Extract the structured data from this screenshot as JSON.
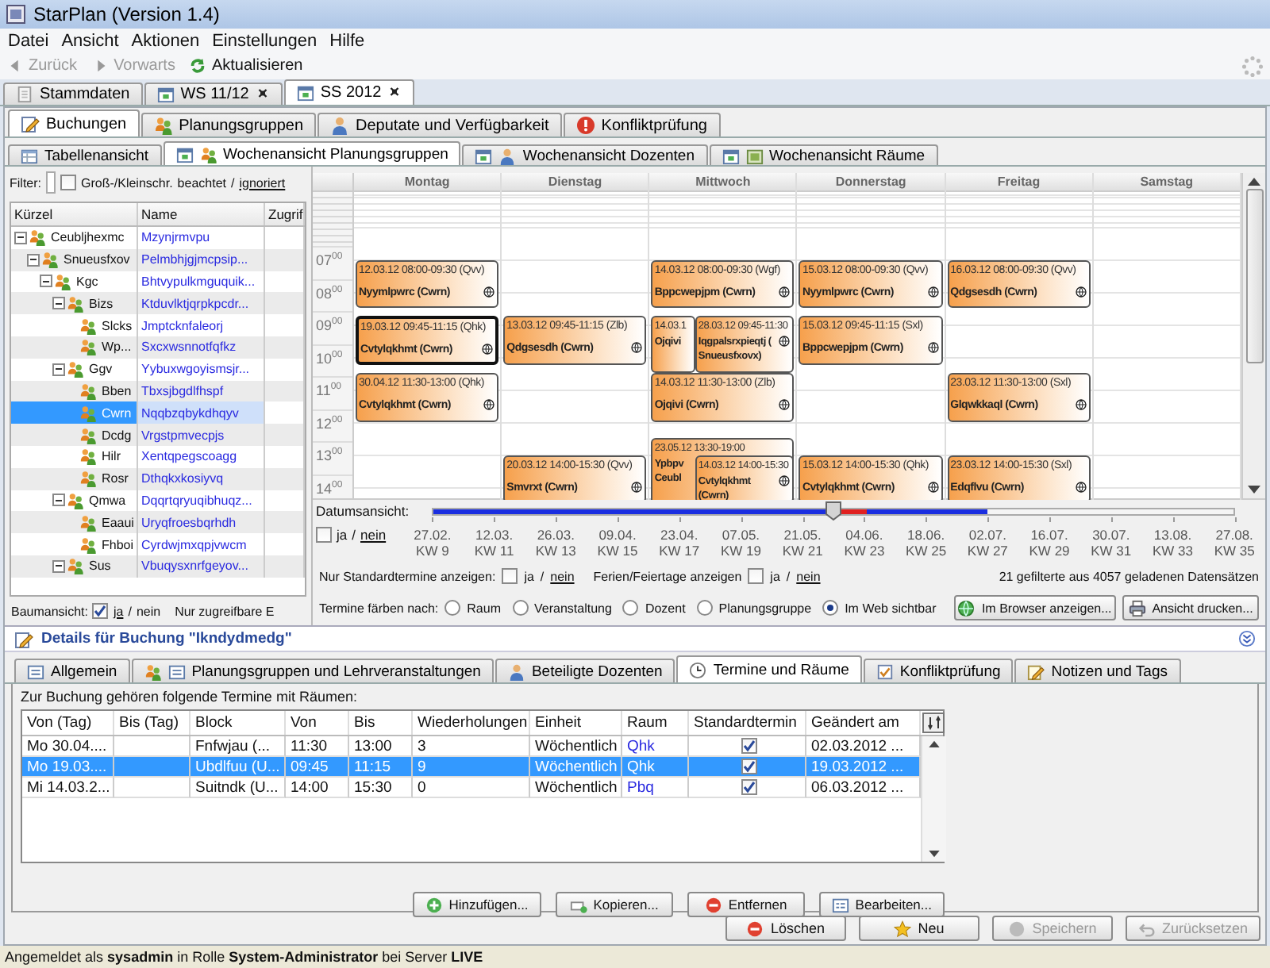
{
  "window": {
    "title": "StarPlan (Version 1.4)"
  },
  "menu": [
    "Datei",
    "Ansicht",
    "Aktionen",
    "Einstellungen",
    "Hilfe"
  ],
  "toolbar": [
    {
      "kind": "back",
      "label": "Zurück",
      "disabled": true
    },
    {
      "kind": "forward",
      "label": "Vorwarts",
      "disabled": true
    },
    {
      "kind": "refresh",
      "label": "Aktualisieren",
      "disabled": false
    }
  ],
  "document_tabs": [
    {
      "kind": "master",
      "label": "Stammdaten",
      "selected": false,
      "pinned": false
    },
    {
      "kind": "semester",
      "label": "WS 11/12",
      "selected": false,
      "pinned": true
    },
    {
      "kind": "semester",
      "label": "SS 2012",
      "selected": true,
      "pinned": true
    }
  ],
  "main_tabs": [
    {
      "kind": "edit",
      "label": "Buchungen",
      "selected": true
    },
    {
      "kind": "group",
      "label": "Planungsgruppen",
      "selected": false
    },
    {
      "kind": "person",
      "label": "Deputate und Verfügbarkeit",
      "selected": false
    },
    {
      "kind": "alert",
      "label": "Konfliktprüfung",
      "selected": false
    }
  ],
  "view_tabs": [
    {
      "kind": "table",
      "label": "Tabellenansicht",
      "selected": false
    },
    {
      "kind": "group",
      "label": "Wochenansicht Planungsgruppen",
      "selected": true
    },
    {
      "kind": "person",
      "label": "Wochenansicht Dozenten",
      "selected": false
    },
    {
      "kind": "room",
      "label": "Wochenansicht Räume",
      "selected": false
    }
  ],
  "filter": {
    "label": "Filter:",
    "case_label": "Groß-/Kleinschr.",
    "case_on": "beachtet",
    "slash": "/",
    "case_off": "ignoriert",
    "checked": false
  },
  "tree": {
    "columns": [
      "Kürzel",
      "Name",
      "Zugrif"
    ],
    "rows": [
      {
        "code": "Ceubljhexmc",
        "name": "Mzynjrmvpu",
        "selected": false,
        "expanded": true,
        "children": [
          {
            "code": "Snueusfxov",
            "name": "Pelmbhjgjmcpsip...",
            "selected": false,
            "expanded": true,
            "children": [
              {
                "code": "Kgc",
                "name": "Bhtvypulkmguquik...",
                "selected": false,
                "expanded": true,
                "children": [
                  {
                    "code": "Bizs",
                    "name": "Ktduvlktjqrpkpcdr...",
                    "selected": false,
                    "expanded": true,
                    "children": [
                      {
                        "code": "Slcks",
                        "name": "Jmptcknfaleorj",
                        "selected": false
                      },
                      {
                        "code": "Wp...",
                        "name": "Sxcxwsnnotfqfkz",
                        "selected": false
                      }
                    ]
                  },
                  {
                    "code": "Ggv",
                    "name": "Yybuxwgoyismsjr...",
                    "selected": false,
                    "expanded": true,
                    "children": [
                      {
                        "code": "Bben",
                        "name": "Tbxsjbgdlfhspf",
                        "selected": false
                      },
                      {
                        "code": "Cwrn",
                        "name": "Nqqbzqbykdhqyv",
                        "selected": true
                      },
                      {
                        "code": "Dcdg",
                        "name": "Vrgstpmvecpjs",
                        "selected": false
                      },
                      {
                        "code": "Hilr",
                        "name": "Xentqpegscoagg",
                        "selected": false
                      },
                      {
                        "code": "Rosr",
                        "name": "Dthqkxkosiyvq",
                        "selected": false
                      }
                    ]
                  },
                  {
                    "code": "Qmwa",
                    "name": "Dqqrtqryuqibhuqz...",
                    "selected": false,
                    "expanded": true,
                    "children": [
                      {
                        "code": "Eaaui",
                        "name": "Uryqfroesbqrhdh",
                        "selected": false
                      },
                      {
                        "code": "Fhboi",
                        "name": "Cyrdwjmxqpjvwcm",
                        "selected": false
                      }
                    ]
                  },
                  {
                    "code": "Sus",
                    "name": "Vbuqysxnrfgeyov...",
                    "selected": false,
                    "expanded": true
                  }
                ]
              }
            ]
          }
        ]
      }
    ]
  },
  "tree_view": {
    "label": "Baumansicht:",
    "checked": true,
    "yes": "ja",
    "slash": "/",
    "no": "nein",
    "access_label": "Nur zugreifbare E"
  },
  "calendar": {
    "hours": [
      "07$^{00}$",
      "08$^{00}$",
      "09$^{00}$",
      "10$^{00}$",
      "11$^{00}$",
      "12$^{00}$",
      "13$^{00}$",
      "14$^{00}$"
    ],
    "days": [
      {
        "name": "Montag",
        "events": [
          {
            "date_line": "12.03.12 08:00-09:30 (Qvv)",
            "name": "Nyymlpwrc (Cwrn)",
            "selected": false
          },
          {
            "date_line": "19.03.12 09:45-11:15 (Qhk)",
            "name": "Cvtylqkhmt (Cwrn)",
            "selected": true
          },
          {
            "date_line": "30.04.12 11:30-13:00 (Qhk)",
            "name": "Cvtylqkhmt (Cwrn)",
            "selected": false
          }
        ]
      },
      {
        "name": "Dienstag",
        "events": [
          {
            "date_line": "13.03.12 09:45-11:15 (Zlb)",
            "name": "Qdgsesdh (Cwrn)",
            "selected": false
          },
          {
            "date_line": "20.03.12 14:00-15:30 (Qvv)",
            "name": "Smvrxt (Cwrn)",
            "selected": false
          }
        ]
      },
      {
        "name": "Mittwoch",
        "events": [
          {
            "date_line": "14.03.12 08:00-09:30 (Wgf)",
            "name": "Bppcwepjpm (Cwrn)",
            "selected": false
          },
          {
            "date_line": "28.03.12 09:45-11:30",
            "name": "Iqgpalsrxpieqtj ( Snueusfxovx)",
            "selected": false,
            "behind": {
              "date_line": "14.03.1",
              "name": "Ojqivi",
              "selected": false
            }
          },
          {
            "date_line": "14.03.12 11:30-13:00 (Zlb)",
            "name": "Ojqivi (Cwrn)",
            "selected": false
          },
          {
            "date_line": "14.03.12 14:00-15:30",
            "name": "Cvtylqkhmt (Cwrn)",
            "selected": false,
            "behind": {
              "date_line": "23.05.12 13:30-19:00",
              "name": "Ypbpv Ceubl",
              "selected": false
            }
          }
        ]
      },
      {
        "name": "Donnerstag",
        "events": [
          {
            "date_line": "15.03.12 08:00-09:30 (Qvv)",
            "name": "Nyymlpwrc (Cwrn)",
            "selected": false
          },
          {
            "date_line": "15.03.12 09:45-11:15 (Sxl)",
            "name": "Bppcwepjpm (Cwrn)",
            "selected": false
          },
          {
            "date_line": "15.03.12 14:00-15:30 (Qhk)",
            "name": "Cvtylqkhmt (Cwrn)",
            "selected": false
          }
        ]
      },
      {
        "name": "Freitag",
        "events": [
          {
            "date_line": "16.03.12 08:00-09:30 (Qvv)",
            "name": "Qdgsesdh (Cwrn)",
            "selected": false
          },
          {
            "date_line": "23.03.12 11:30-13:00 (Sxl)",
            "name": "Glqwkkaql (Cwrn)",
            "selected": false
          },
          {
            "date_line": "23.03.12 14:00-15:30 (Sxl)",
            "name": "Edqflvu (Cwrn)",
            "selected": false
          }
        ]
      },
      {
        "name": "Samstag"
      }
    ]
  },
  "timeline": {
    "label": "Datumsansicht:",
    "checked": false,
    "yes": "ja",
    "slash": "/",
    "no": "nein",
    "level": 0.5,
    "ticks": [
      {
        "date": "27.02.",
        "week": "KW 9",
        "loaded": true
      },
      {
        "date": "12.03.",
        "week": "KW 11",
        "loaded": true
      },
      {
        "date": "26.03.",
        "week": "KW 13",
        "loaded": true
      },
      {
        "date": "09.04.",
        "week": "KW 15",
        "loaded": true
      },
      {
        "date": "23.04.",
        "week": "KW 17",
        "loaded": true
      },
      {
        "date": "07.05.",
        "week": "KW 19",
        "loaded": true
      },
      {
        "date": "21.05.",
        "week": "KW 21",
        "loaded": true
      },
      {
        "date": "04.06.",
        "week": "KW 23",
        "loaded": true
      },
      {
        "date": "18.06.",
        "week": "KW 25",
        "loaded": true
      },
      {
        "date": "02.07.",
        "week": "KW 27",
        "loaded": false
      },
      {
        "date": "16.07.",
        "week": "KW 29",
        "loaded": false
      },
      {
        "date": "30.07.",
        "week": "KW 31",
        "loaded": false
      },
      {
        "date": "13.08.",
        "week": "KW 33",
        "loaded": false
      },
      {
        "date": "27.08.",
        "week": "KW 35",
        "loaded": false
      }
    ]
  },
  "options": {
    "standard": {
      "label": "Nur Standardtermine anzeigen:",
      "checked": false,
      "yes": "ja",
      "slash": "/",
      "no": "nein"
    },
    "holidays": {
      "label": "Ferien/Feiertage anzeigen",
      "checked": false,
      "yes": "ja",
      "slash": "/",
      "no": "nein"
    },
    "count": "21 gefilterte aus 4057 geladenen Datensätzen",
    "color_label": "Termine färben nach:",
    "color_by": [
      {
        "label": "Raum",
        "selected": false
      },
      {
        "label": "Veranstaltung",
        "selected": false
      },
      {
        "label": "Dozent",
        "selected": false
      },
      {
        "label": "Planungsgruppe",
        "selected": false
      },
      {
        "label": "Im Web sichtbar",
        "selected": true
      }
    ],
    "buttons": [
      {
        "kind": "browser",
        "label": "Im Browser anzeigen..."
      },
      {
        "kind": "print",
        "label": "Ansicht drucken..."
      }
    ]
  },
  "details": {
    "title": "Details für Buchung \"Ikndydmedg\"",
    "tabs": [
      {
        "kind": "general",
        "label": "Allgemein",
        "selected": false
      },
      {
        "kind": "group",
        "label": "Planungsgruppen und Lehrveranstaltungen",
        "selected": false
      },
      {
        "kind": "person",
        "label": "Beteiligte Dozenten",
        "selected": false
      },
      {
        "kind": "clock",
        "label": "Termine und Räume",
        "selected": true
      },
      {
        "kind": "check",
        "label": "Konfliktprüfung",
        "selected": false
      },
      {
        "kind": "notes",
        "label": "Notizen und Tags",
        "selected": false
      }
    ],
    "intro": "Zur Buchung gehören folgende Termine mit Räumen:",
    "columns": [
      "Von (Tag)",
      "Bis (Tag)",
      "Block",
      "Von",
      "Bis",
      "Wiederholungen",
      "Einheit",
      "Raum",
      "Standardtermin",
      "Geändert am"
    ],
    "rows": [
      {
        "from_day": "Mo 30.04....",
        "block": "Fnfwjau (...",
        "from": "11:30",
        "to": "13:00",
        "repeats": "3",
        "unit": "Wöchentlich",
        "room": "Qhk",
        "standard": true,
        "changed": "02.03.2012 ...",
        "selected": false
      },
      {
        "from_day": "Mo 19.03....",
        "block": "Ubdlfuu (U...",
        "from": "09:45",
        "to": "11:15",
        "repeats": "9",
        "unit": "Wöchentlich",
        "room": "Qhk",
        "standard": true,
        "changed": "19.03.2012 ...",
        "selected": true
      },
      {
        "from_day": "Mi 14.03.2...",
        "block": "Suitndk (U...",
        "from": "14:00",
        "to": "15:30",
        "repeats": "0",
        "unit": "Wöchentlich",
        "room": "Pbq",
        "standard": true,
        "changed": "06.03.2012 ...",
        "selected": false
      }
    ],
    "buttons": [
      {
        "kind": "add",
        "label": "Hinzufügen..."
      },
      {
        "kind": "copy",
        "label": "Kopieren..."
      },
      {
        "kind": "remove",
        "label": "Entfernen"
      },
      {
        "kind": "edit",
        "label": "Bearbeiten..."
      }
    ]
  },
  "footer_buttons": [
    {
      "kind": "delete",
      "label": "Löschen",
      "disabled": false
    },
    {
      "kind": "new",
      "label": "Neu",
      "disabled": false
    },
    {
      "kind": "save",
      "label": "Speichern",
      "disabled": true
    },
    {
      "kind": "reset",
      "label": "Zurücksetzen",
      "disabled": true
    }
  ],
  "status_bar": "Angemeldet als **sysadmin** in Rolle **System-Administrator** bei Server **LIVE**"
}
